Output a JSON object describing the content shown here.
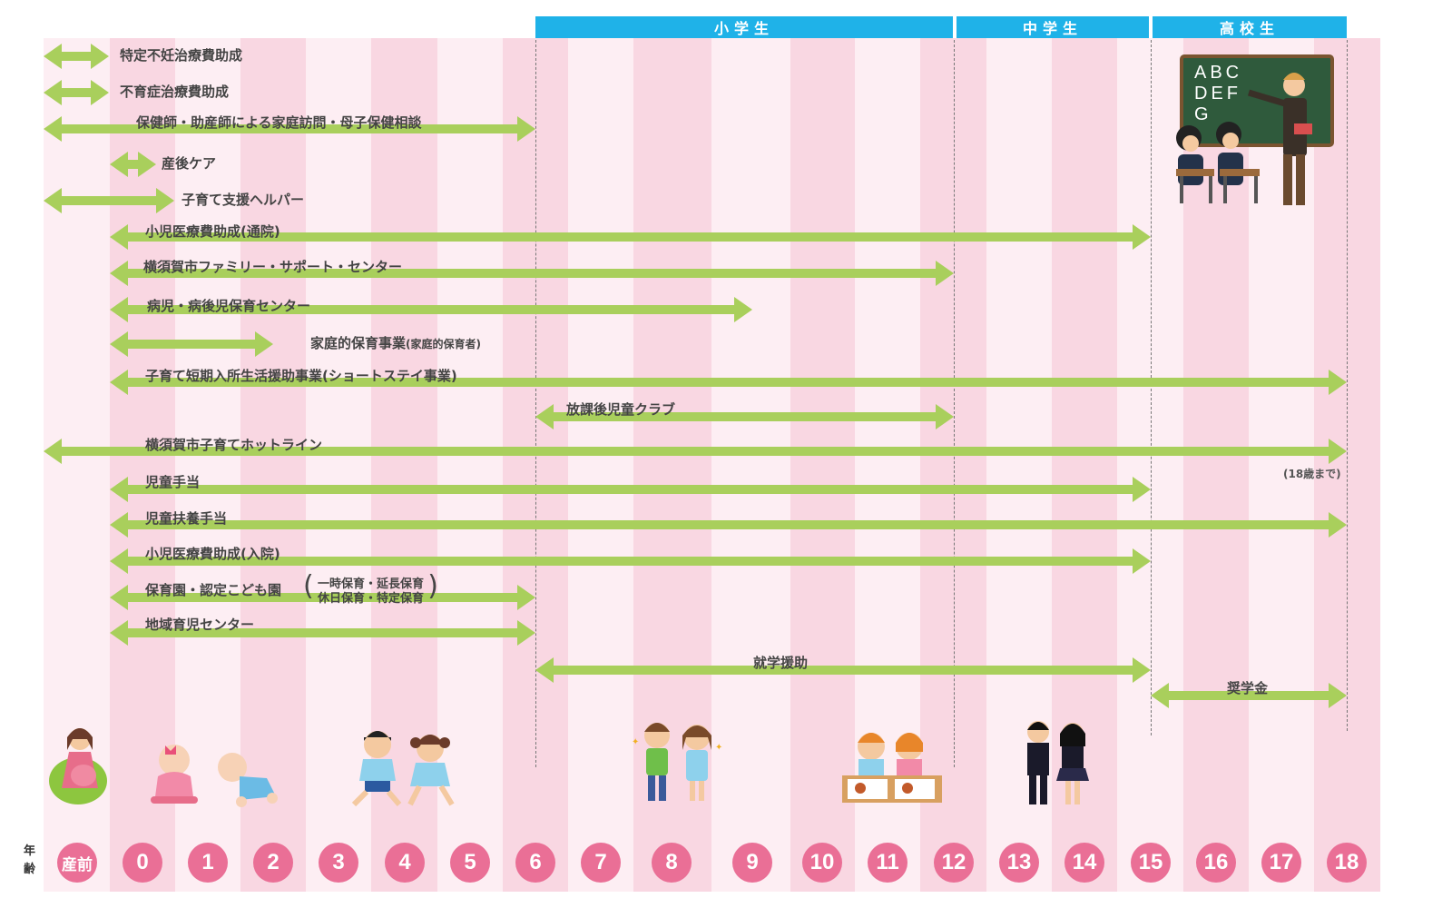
{
  "school_headers": [
    {
      "label": "小学生"
    },
    {
      "label": "中学生"
    },
    {
      "label": "高校生"
    }
  ],
  "age_header": "年齢",
  "ages": [
    "産前",
    "0",
    "1",
    "2",
    "3",
    "4",
    "5",
    "6",
    "7",
    "8",
    "9",
    "10",
    "11",
    "12",
    "13",
    "14",
    "15",
    "16",
    "17",
    "18"
  ],
  "colors": {
    "bar": "#a9cf5c",
    "school_band": "#1fb2e8",
    "age_circle": "#ea6f96",
    "col_light": "#fdeef3",
    "col_dark": "#f9d7e2"
  },
  "services": [
    {
      "label": "特定不妊治療費助成",
      "from": "産前",
      "to": "産前"
    },
    {
      "label": "不育症治療費助成",
      "from": "産前",
      "to": "産前"
    },
    {
      "label": "保健師・助産師による家庭訪問・母子保健相談",
      "from": "産前",
      "to": "6"
    },
    {
      "label": "産後ケア",
      "from": "0",
      "to": "0"
    },
    {
      "label": "子育て支援ヘルパー",
      "from": "産前",
      "to": "1"
    },
    {
      "label": "小児医療費助成(通院)",
      "from": "0",
      "to": "15"
    },
    {
      "label": "横須賀市ファミリー・サポート・センター",
      "from": "0",
      "to": "12"
    },
    {
      "label": "病児・病後児保育センター",
      "from": "0",
      "to": "9"
    },
    {
      "label": "家庭的保育事業",
      "sub": "(家庭的保育者)",
      "from": "0",
      "to": "2"
    },
    {
      "label": "子育て短期入所生活援助事業(ショートステイ事業)",
      "from": "0",
      "to": "18"
    },
    {
      "label": "放課後児童クラブ",
      "from": "6",
      "to": "12"
    },
    {
      "label": "横須賀市子育てホットライン",
      "from": "産前",
      "to": "18",
      "note": "(18歳まで)"
    },
    {
      "label": "児童手当",
      "from": "0",
      "to": "15"
    },
    {
      "label": "児童扶養手当",
      "from": "0",
      "to": "18"
    },
    {
      "label": "小児医療費助成(入院)",
      "from": "0",
      "to": "15"
    },
    {
      "label": "保育園・認定こども園",
      "paren_line1": "一時保育・延長保育",
      "paren_line2": "休日保育・特定保育",
      "from": "0",
      "to": "6"
    },
    {
      "label": "地域育児センター",
      "from": "0",
      "to": "6"
    },
    {
      "label": "就学援助",
      "from": "6",
      "to": "15"
    },
    {
      "label": "奨学金",
      "from": "15",
      "to": "18"
    }
  ],
  "chalkboard": {
    "line1": "ABC",
    "line2": "DEF",
    "line3": "G"
  }
}
